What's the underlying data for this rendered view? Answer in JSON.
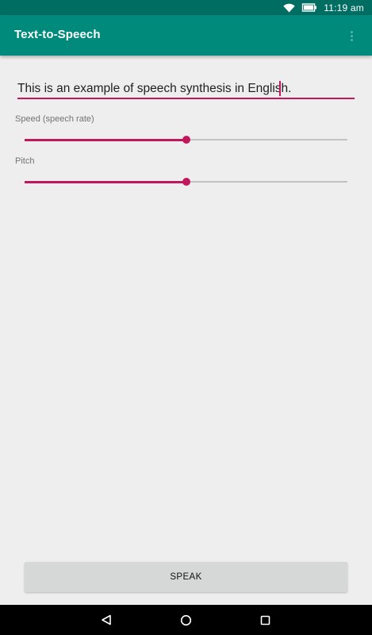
{
  "status_bar": {
    "time": "11:19 am",
    "icons": [
      "wifi-icon",
      "battery-icon"
    ]
  },
  "app_bar": {
    "title": "Text-to-Speech",
    "overflow_icon": "more-vert-icon"
  },
  "colors": {
    "status_bar": "#006d62",
    "app_bar": "#008a7c",
    "accent": "#c2185b",
    "background": "#eeeeee",
    "button": "#d6d7d7",
    "nav_bar": "#000000"
  },
  "input": {
    "value": "This is an example of speech synthesis in English."
  },
  "speed": {
    "label": "Speed (speech rate)",
    "value": 0.5
  },
  "pitch": {
    "label": "Pitch",
    "value": 0.5
  },
  "speak_button": {
    "label": "SPEAK"
  },
  "nav_bar": {
    "icons": [
      "back-icon",
      "home-icon",
      "recents-icon"
    ]
  }
}
